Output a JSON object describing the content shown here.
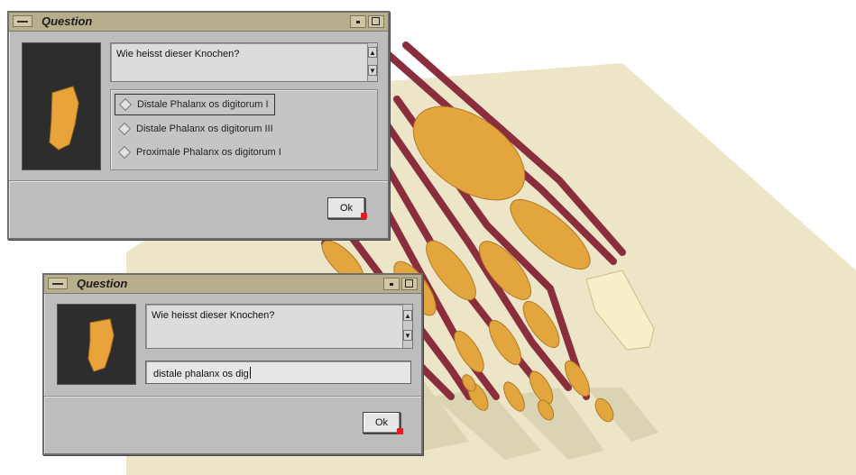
{
  "colors": {
    "bone": "#e3a53e",
    "tendon": "#8a2d3d",
    "floor": "#ece5c8",
    "window_chrome": "#b7ae8c",
    "dialog_bg": "#bdbdbd",
    "cursor": "#e02020"
  },
  "icons": {
    "window_menu": "window-menu-icon",
    "minimize": "minimize-icon",
    "maximize": "maximize-icon",
    "scroll_up": "scroll-up-arrow-icon",
    "scroll_down": "scroll-down-arrow-icon",
    "radio": "radio-diamond-icon",
    "cursor": "mouse-cursor-icon"
  },
  "dialog_top": {
    "title": "Question",
    "question": "Wie heisst dieser Knochen?",
    "options": [
      {
        "label": "Distale Phalanx os digitorum I",
        "selected": true
      },
      {
        "label": "Distale Phalanx os digitorum III",
        "selected": false
      },
      {
        "label": "Proximale Phalanx os digitorum I",
        "selected": false
      }
    ],
    "ok_label": "Ok"
  },
  "dialog_bottom": {
    "title": "Question",
    "question": "Wie heisst dieser Knochen?",
    "answer_value": "distale phalanx os dig",
    "ok_label": "Ok"
  }
}
